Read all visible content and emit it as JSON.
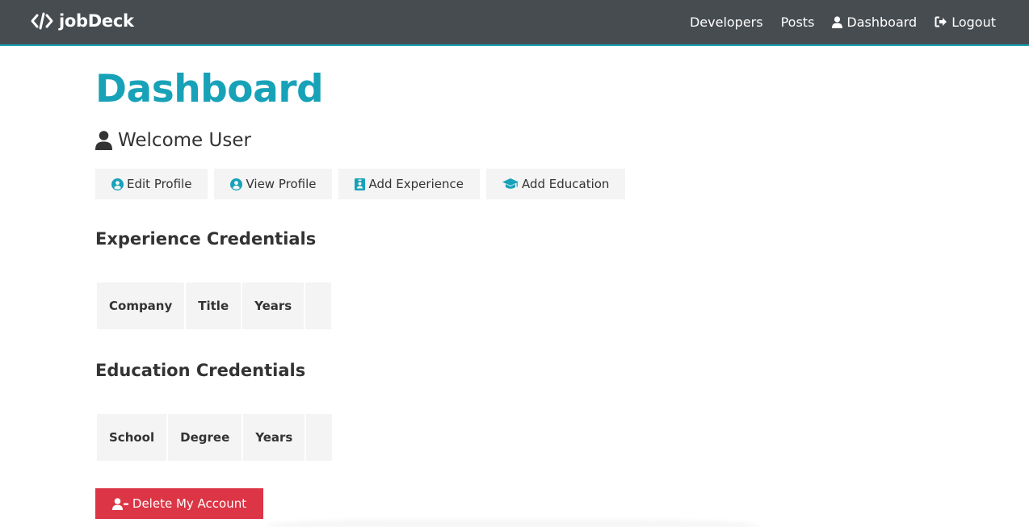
{
  "navbar": {
    "brand": "jobDeck",
    "links": [
      {
        "label": "Developers"
      },
      {
        "label": "Posts"
      },
      {
        "label": "Dashboard",
        "icon": "user-icon"
      },
      {
        "label": "Logout",
        "icon": "sign-out-icon"
      }
    ]
  },
  "dashboard": {
    "title": "Dashboard",
    "welcome": "Welcome User",
    "buttons": [
      {
        "label": "Edit Profile",
        "icon": "user-circle-icon"
      },
      {
        "label": "View Profile",
        "icon": "user-circle-icon"
      },
      {
        "label": "Add Experience",
        "icon": "id-badge-icon"
      },
      {
        "label": "Add Education",
        "icon": "graduation-cap-icon"
      }
    ]
  },
  "experience": {
    "title": "Experience Credentials",
    "columns": [
      "Company",
      "Title",
      "Years",
      ""
    ]
  },
  "education": {
    "title": "Education Credentials",
    "columns": [
      "School",
      "Degree",
      "Years",
      ""
    ]
  },
  "delete_button": {
    "label": "Delete My Account",
    "icon": "user-minus-icon"
  },
  "colors": {
    "navbar_bg": "#474c51",
    "primary": "#17a2b8",
    "light": "#f4f4f4",
    "danger": "#dc3545",
    "text": "#333333"
  }
}
